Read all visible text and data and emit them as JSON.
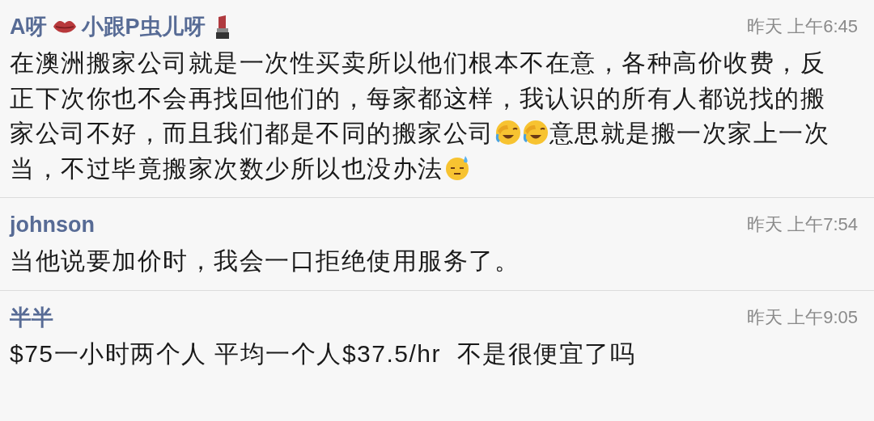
{
  "comments": [
    {
      "name": [
        {
          "kind": "text",
          "text": "A呀"
        },
        {
          "kind": "lips"
        },
        {
          "kind": "text",
          "text": "小跟P虫儿呀"
        },
        {
          "kind": "lipstick"
        }
      ],
      "time": "昨天 上午6:45",
      "body": [
        {
          "kind": "text",
          "text": "在澳洲搬家公司就是一次性买卖所以他们根本不在意，各种高价收费，反正下次你也不会再找回他们的，每家都这样，我认识的所有人都说找的搬家公司不好，而且我们都是不同的搬家公司"
        },
        {
          "kind": "facepalm"
        },
        {
          "kind": "facepalm"
        },
        {
          "kind": "text",
          "text": "意思就是搬一次家上一次当，不过毕竟搬家次数少所以也没办法"
        },
        {
          "kind": "sweat"
        }
      ]
    },
    {
      "name": [
        {
          "kind": "text",
          "text": "johnson"
        }
      ],
      "time": "昨天 上午7:54",
      "body": [
        {
          "kind": "text",
          "text": "当他说要加价时，我会一口拒绝使用服务了。"
        }
      ]
    },
    {
      "name": [
        {
          "kind": "text",
          "text": "半半"
        }
      ],
      "time": "昨天 上午9:05",
      "body": [
        {
          "kind": "text",
          "text": "$75一小时两个人 平均一个人$37.5/hr  不是很便宜了吗"
        }
      ]
    }
  ]
}
